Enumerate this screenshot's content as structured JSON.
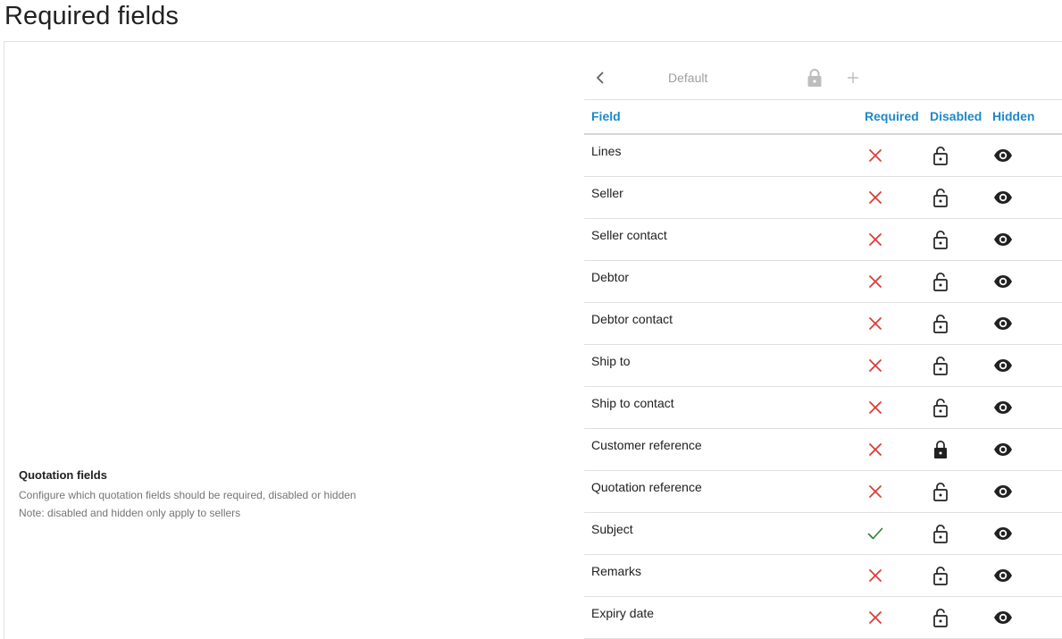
{
  "page": {
    "title": "Required fields"
  },
  "section": {
    "heading": "Quotation fields",
    "description": "Configure which quotation fields should be required, disabled or hidden",
    "note": "Note: disabled and hidden only apply to sellers"
  },
  "toolbar": {
    "profile_name": "Default",
    "back_icon": "chevron-left-icon",
    "lock_icon": "lock-icon",
    "add_icon": "plus-icon"
  },
  "colors": {
    "accent": "#1e88c8",
    "cross": "#e53935",
    "check": "#2e7d32",
    "icon": "#212121",
    "muted": "#bdbdbd"
  },
  "table": {
    "headers": {
      "field": "Field",
      "required": "Required",
      "disabled": "Disabled",
      "hidden": "Hidden"
    },
    "rows": [
      {
        "field": "Lines",
        "required": false,
        "disabled": false,
        "hidden": false
      },
      {
        "field": "Seller",
        "required": false,
        "disabled": false,
        "hidden": false
      },
      {
        "field": "Seller contact",
        "required": false,
        "disabled": false,
        "hidden": false
      },
      {
        "field": "Debtor",
        "required": false,
        "disabled": false,
        "hidden": false
      },
      {
        "field": "Debtor contact",
        "required": false,
        "disabled": false,
        "hidden": false
      },
      {
        "field": "Ship to",
        "required": false,
        "disabled": false,
        "hidden": false
      },
      {
        "field": "Ship to contact",
        "required": false,
        "disabled": false,
        "hidden": false
      },
      {
        "field": "Customer reference",
        "required": false,
        "disabled": true,
        "hidden": false
      },
      {
        "field": "Quotation reference",
        "required": false,
        "disabled": false,
        "hidden": false
      },
      {
        "field": "Subject",
        "required": true,
        "disabled": false,
        "hidden": false
      },
      {
        "field": "Remarks",
        "required": false,
        "disabled": false,
        "hidden": false
      },
      {
        "field": "Expiry date",
        "required": false,
        "disabled": false,
        "hidden": false
      }
    ]
  }
}
